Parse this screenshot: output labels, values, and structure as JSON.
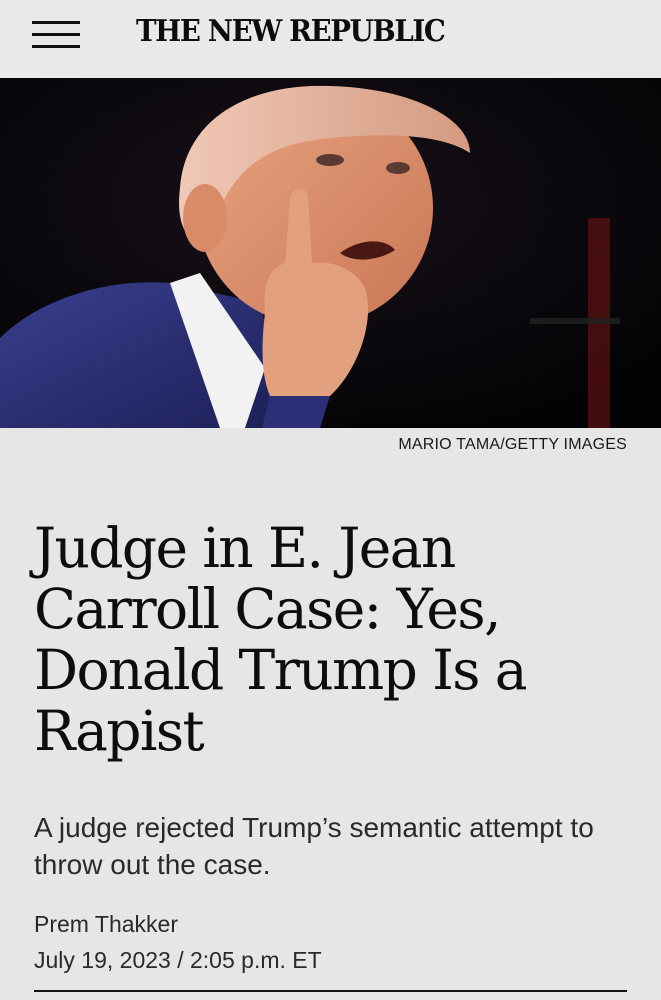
{
  "header": {
    "menu_icon": "hamburger-menu-icon",
    "logo_text": "THE NEW REPUBLIC"
  },
  "hero": {
    "image_description": "photo-of-speaker-in-suit-pointing-finger",
    "credit": "MARIO TAMA/GETTY IMAGES"
  },
  "article": {
    "headline": "Judge in E. Jean Carroll Case: Yes, Donald Trump Is a Rapist",
    "dek": "A judge rejected Trump’s semantic attempt to throw out the case.",
    "author": "Prem Thakker",
    "dateline": "July 19, 2023 / 2:05 p.m. ET"
  },
  "colors": {
    "page_background": "#e6e6e6",
    "text": "#111111",
    "hero_background": "#050507"
  }
}
